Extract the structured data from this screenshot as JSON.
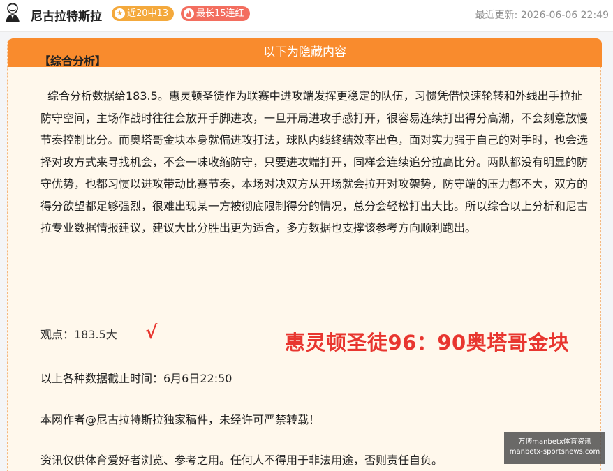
{
  "header": {
    "author_name": "尼古拉特斯拉",
    "badges": [
      {
        "icon": "star-icon",
        "label": "近20中13",
        "color": "#f4a93c"
      },
      {
        "icon": "flame-icon",
        "label": "最长15连红",
        "color": "#f36e5f"
      }
    ],
    "updated_label": "最近更新:",
    "updated_time": "2026-06-06 22:49"
  },
  "card": {
    "header_text": "以下为隐藏内容",
    "section_title": "【综合分析】",
    "analysis_paragraph": "综合分析数据给183.5。惠灵顿圣徒作为联赛中进攻端发挥更稳定的队伍，习惯凭借快速轮转和外线出手拉扯防守空间，主场作战时往往会放开手脚进攻，一旦开局进攻手感打开，很容易连续打出得分高潮，不会刻意放慢节奏控制比分。而奥塔哥金块本身就偏进攻打法，球队内线终结效率出色，面对实力强于自己的对手时，也会选择对攻方式来寻找机会，不会一味收缩防守，只要进攻端打开，同样会连续追分拉高比分。两队都没有明显的防守优势，也都习惯以进攻带动比赛节奏，本场对决双方从开场就会拉开对攻架势，防守端的压力都不大，双方的得分欲望都足够强烈，很难出现某一方被彻底限制得分的情况，总分会轻松打出大比。所以综合以上分析和尼古拉专业数据情报建议，建议大比分胜出更为适合，多方数据也支撑该参考方向顺利跑出。",
    "view_label": "观点：183.5大",
    "check_mark": "√",
    "final_score": "惠灵顿圣徒96：90奥塔哥金块",
    "cutoff_text": "以上各种数据截止时间：6月6日22:50",
    "copyright_text": "本网作者@尼古拉特斯拉独家稿件，未经许可严禁转载！",
    "disclaimer_text": "资讯仅供体育爱好者浏览、参考之用。任何人不得用于非法用途，否则责任自负。"
  },
  "watermark": {
    "line1": "万博manbetx体育资讯",
    "line2": "manbetx-sportsnews.com"
  }
}
